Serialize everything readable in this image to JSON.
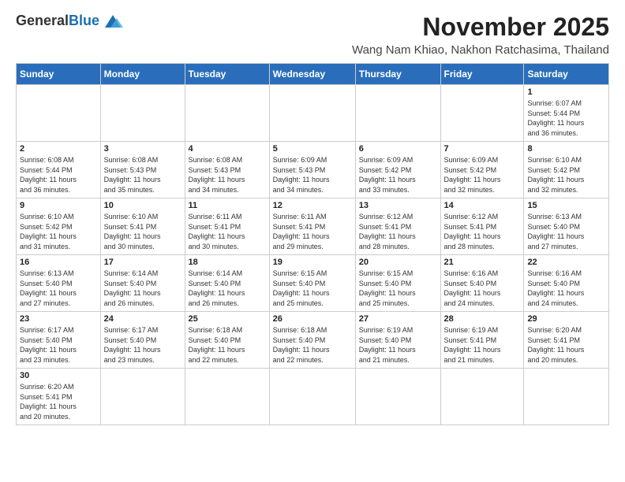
{
  "logo": {
    "general": "General",
    "blue": "Blue"
  },
  "title": "November 2025",
  "location": "Wang Nam Khiao, Nakhon Ratchasima, Thailand",
  "headers": [
    "Sunday",
    "Monday",
    "Tuesday",
    "Wednesday",
    "Thursday",
    "Friday",
    "Saturday"
  ],
  "weeks": [
    [
      {
        "day": "",
        "info": ""
      },
      {
        "day": "",
        "info": ""
      },
      {
        "day": "",
        "info": ""
      },
      {
        "day": "",
        "info": ""
      },
      {
        "day": "",
        "info": ""
      },
      {
        "day": "",
        "info": ""
      },
      {
        "day": "1",
        "info": "Sunrise: 6:07 AM\nSunset: 5:44 PM\nDaylight: 11 hours\nand 36 minutes."
      }
    ],
    [
      {
        "day": "2",
        "info": "Sunrise: 6:08 AM\nSunset: 5:44 PM\nDaylight: 11 hours\nand 36 minutes."
      },
      {
        "day": "3",
        "info": "Sunrise: 6:08 AM\nSunset: 5:43 PM\nDaylight: 11 hours\nand 35 minutes."
      },
      {
        "day": "4",
        "info": "Sunrise: 6:08 AM\nSunset: 5:43 PM\nDaylight: 11 hours\nand 34 minutes."
      },
      {
        "day": "5",
        "info": "Sunrise: 6:09 AM\nSunset: 5:43 PM\nDaylight: 11 hours\nand 34 minutes."
      },
      {
        "day": "6",
        "info": "Sunrise: 6:09 AM\nSunset: 5:42 PM\nDaylight: 11 hours\nand 33 minutes."
      },
      {
        "day": "7",
        "info": "Sunrise: 6:09 AM\nSunset: 5:42 PM\nDaylight: 11 hours\nand 32 minutes."
      },
      {
        "day": "8",
        "info": "Sunrise: 6:10 AM\nSunset: 5:42 PM\nDaylight: 11 hours\nand 32 minutes."
      }
    ],
    [
      {
        "day": "9",
        "info": "Sunrise: 6:10 AM\nSunset: 5:42 PM\nDaylight: 11 hours\nand 31 minutes."
      },
      {
        "day": "10",
        "info": "Sunrise: 6:10 AM\nSunset: 5:41 PM\nDaylight: 11 hours\nand 30 minutes."
      },
      {
        "day": "11",
        "info": "Sunrise: 6:11 AM\nSunset: 5:41 PM\nDaylight: 11 hours\nand 30 minutes."
      },
      {
        "day": "12",
        "info": "Sunrise: 6:11 AM\nSunset: 5:41 PM\nDaylight: 11 hours\nand 29 minutes."
      },
      {
        "day": "13",
        "info": "Sunrise: 6:12 AM\nSunset: 5:41 PM\nDaylight: 11 hours\nand 28 minutes."
      },
      {
        "day": "14",
        "info": "Sunrise: 6:12 AM\nSunset: 5:41 PM\nDaylight: 11 hours\nand 28 minutes."
      },
      {
        "day": "15",
        "info": "Sunrise: 6:13 AM\nSunset: 5:40 PM\nDaylight: 11 hours\nand 27 minutes."
      }
    ],
    [
      {
        "day": "16",
        "info": "Sunrise: 6:13 AM\nSunset: 5:40 PM\nDaylight: 11 hours\nand 27 minutes."
      },
      {
        "day": "17",
        "info": "Sunrise: 6:14 AM\nSunset: 5:40 PM\nDaylight: 11 hours\nand 26 minutes."
      },
      {
        "day": "18",
        "info": "Sunrise: 6:14 AM\nSunset: 5:40 PM\nDaylight: 11 hours\nand 26 minutes."
      },
      {
        "day": "19",
        "info": "Sunrise: 6:15 AM\nSunset: 5:40 PM\nDaylight: 11 hours\nand 25 minutes."
      },
      {
        "day": "20",
        "info": "Sunrise: 6:15 AM\nSunset: 5:40 PM\nDaylight: 11 hours\nand 25 minutes."
      },
      {
        "day": "21",
        "info": "Sunrise: 6:16 AM\nSunset: 5:40 PM\nDaylight: 11 hours\nand 24 minutes."
      },
      {
        "day": "22",
        "info": "Sunrise: 6:16 AM\nSunset: 5:40 PM\nDaylight: 11 hours\nand 24 minutes."
      }
    ],
    [
      {
        "day": "23",
        "info": "Sunrise: 6:17 AM\nSunset: 5:40 PM\nDaylight: 11 hours\nand 23 minutes."
      },
      {
        "day": "24",
        "info": "Sunrise: 6:17 AM\nSunset: 5:40 PM\nDaylight: 11 hours\nand 23 minutes."
      },
      {
        "day": "25",
        "info": "Sunrise: 6:18 AM\nSunset: 5:40 PM\nDaylight: 11 hours\nand 22 minutes."
      },
      {
        "day": "26",
        "info": "Sunrise: 6:18 AM\nSunset: 5:40 PM\nDaylight: 11 hours\nand 22 minutes."
      },
      {
        "day": "27",
        "info": "Sunrise: 6:19 AM\nSunset: 5:40 PM\nDaylight: 11 hours\nand 21 minutes."
      },
      {
        "day": "28",
        "info": "Sunrise: 6:19 AM\nSunset: 5:41 PM\nDaylight: 11 hours\nand 21 minutes."
      },
      {
        "day": "29",
        "info": "Sunrise: 6:20 AM\nSunset: 5:41 PM\nDaylight: 11 hours\nand 20 minutes."
      }
    ],
    [
      {
        "day": "30",
        "info": "Sunrise: 6:20 AM\nSunset: 5:41 PM\nDaylight: 11 hours\nand 20 minutes."
      },
      {
        "day": "",
        "info": ""
      },
      {
        "day": "",
        "info": ""
      },
      {
        "day": "",
        "info": ""
      },
      {
        "day": "",
        "info": ""
      },
      {
        "day": "",
        "info": ""
      },
      {
        "day": "",
        "info": ""
      }
    ]
  ]
}
